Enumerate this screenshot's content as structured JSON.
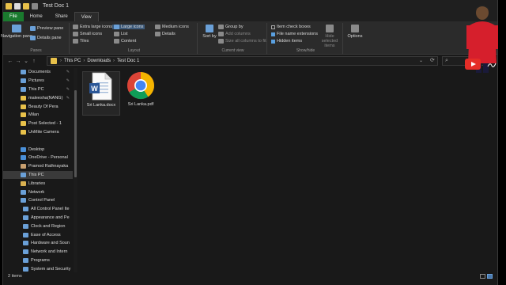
{
  "window": {
    "title": "Test Doc 1"
  },
  "tabs": [
    "File",
    "Home",
    "Share",
    "View"
  ],
  "ribbon": {
    "panes": {
      "navigation_pane": "Navigation pane",
      "preview_pane": "Preview pane",
      "details_pane": "Details pane",
      "label": "Panes"
    },
    "layout": {
      "items": [
        "Extra large icons",
        "Large icons",
        "Medium icons",
        "Small icons",
        "List",
        "Details",
        "Tiles",
        "Content"
      ],
      "selected": "Large icons",
      "label": "Layout"
    },
    "current_view": {
      "sort_by": "Sort by",
      "group_by": "Group by",
      "add_columns": "Add columns",
      "size_all_columns": "Size all columns to fit",
      "label": "Current view"
    },
    "show_hide": {
      "item_check_boxes": "Item check boxes",
      "file_name_extensions": "File name extensions",
      "hidden_items": "Hidden items",
      "hide_selected": "Hide selected items",
      "label": "Show/hide"
    },
    "options": "Options"
  },
  "address": {
    "crumbs": [
      "This PC",
      "Downloads",
      "Test Doc 1"
    ]
  },
  "nav": {
    "items": [
      {
        "label": "Documents",
        "pinned": true,
        "color": "#6aa0d8"
      },
      {
        "label": "Pictures",
        "pinned": true,
        "color": "#6aa0d8"
      },
      {
        "label": "This PC",
        "pinned": true,
        "color": "#6aa0d8"
      },
      {
        "label": "maleesha(NANG)",
        "pinned": true,
        "color": "#e8c14a"
      },
      {
        "label": "Beauty Of Pera",
        "pinned": false,
        "color": "#e8c14a"
      },
      {
        "label": "Milan",
        "pinned": false,
        "color": "#e8c14a"
      },
      {
        "label": "Post Selected - 1",
        "pinned": false,
        "color": "#e8c14a"
      },
      {
        "label": "UnMite Camera",
        "pinned": false,
        "color": "#e8c14a"
      },
      {
        "label": "",
        "pinned": false,
        "color": ""
      },
      {
        "label": "Desktop",
        "pinned": false,
        "color": "#4a90d9"
      },
      {
        "label": "OneDrive - Personal",
        "pinned": false,
        "color": "#4a90d9"
      },
      {
        "label": "Pramod Rathnayaka",
        "pinned": false,
        "color": "#c8a070"
      },
      {
        "label": "This PC",
        "pinned": false,
        "color": "#6aa0d8"
      },
      {
        "label": "Libraries",
        "pinned": false,
        "color": "#d8b050"
      },
      {
        "label": "Network",
        "pinned": false,
        "color": "#6aa0d8"
      },
      {
        "label": "Control Panel",
        "pinned": false,
        "color": "#6aa0d8"
      },
      {
        "label": "All Control Panel Ite",
        "pinned": false,
        "color": "#6aa0d8"
      },
      {
        "label": "Appearance and Pe",
        "pinned": false,
        "color": "#6aa0d8"
      },
      {
        "label": "Clock and Region",
        "pinned": false,
        "color": "#6aa0d8"
      },
      {
        "label": "Ease of Access",
        "pinned": false,
        "color": "#6aa0d8"
      },
      {
        "label": "Hardware and Soun",
        "pinned": false,
        "color": "#6aa0d8"
      },
      {
        "label": "Network and Intern",
        "pinned": false,
        "color": "#6aa0d8"
      },
      {
        "label": "Programs",
        "pinned": false,
        "color": "#6aa0d8"
      },
      {
        "label": "System and Security",
        "pinned": false,
        "color": "#6aa0d8"
      }
    ],
    "selected": 12
  },
  "files": [
    {
      "name": "Sri Lanka.docx",
      "icon": "word-document-icon"
    },
    {
      "name": "Sri Lanka.pdf",
      "icon": "chrome-pdf-icon"
    }
  ],
  "status": {
    "count": "2 items"
  },
  "colors": {
    "accent": "#1a7a2e",
    "selection": "#3a3a3a"
  }
}
